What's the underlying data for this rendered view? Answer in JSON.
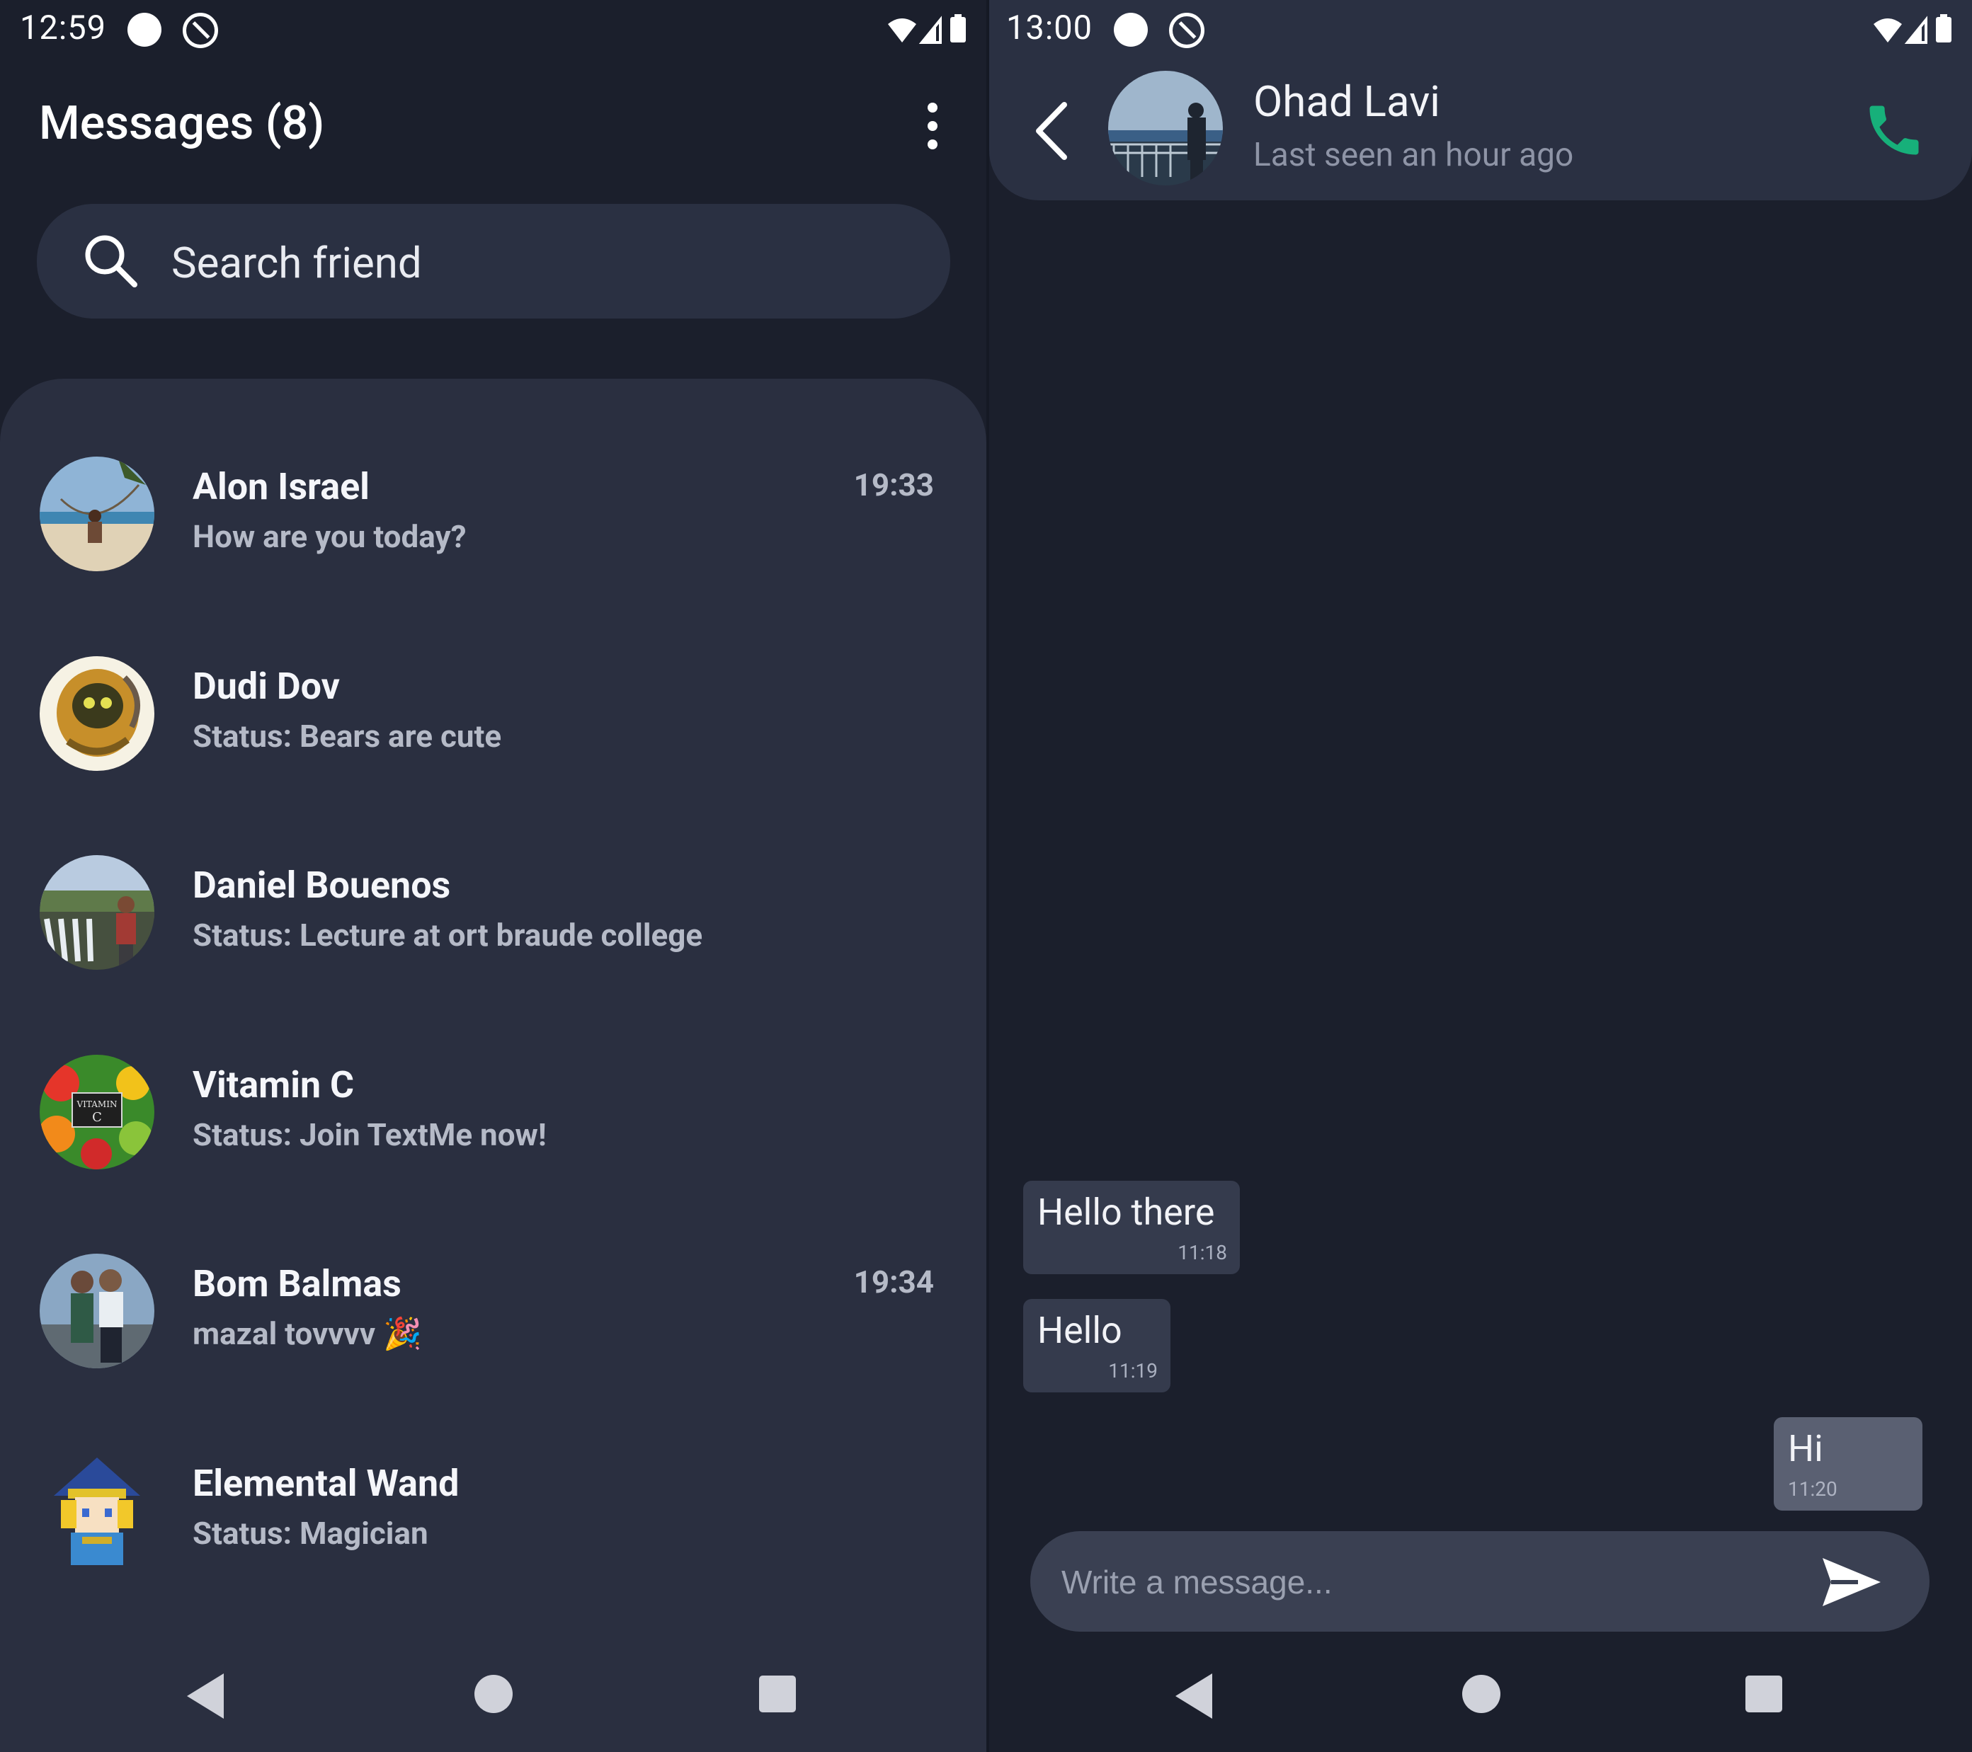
{
  "colors": {
    "background": "#1b1f2c",
    "card": "#2a2f40",
    "accent_call": "#17b07a"
  },
  "left": {
    "status_time": "12:59",
    "title": "Messages (8)",
    "search_placeholder": "Search friend",
    "contacts": [
      {
        "name": "Alon Israel",
        "subtitle": "How are you today?",
        "time": "19:33",
        "avatar": "beach-hammock-photo"
      },
      {
        "name": "Dudi Dov",
        "subtitle": "Status: Bears are cute",
        "time": "",
        "avatar": "creature-illustration"
      },
      {
        "name": "Daniel Bouenos",
        "subtitle": "Status: Lecture at ort braude college",
        "time": "",
        "avatar": "waterfall-photo"
      },
      {
        "name": "Vitamin C",
        "subtitle": "Status: Join TextMe now!",
        "time": "",
        "avatar": "fruits-photo"
      },
      {
        "name": "Bom Balmas",
        "subtitle": "mazal tovvvv 🎉",
        "time": "19:34",
        "avatar": "couple-photo"
      },
      {
        "name": "Elemental Wand",
        "subtitle": "Status: Magician",
        "time": "",
        "avatar": "pixel-wizard"
      }
    ]
  },
  "right": {
    "status_time": "13:00",
    "contact_name": "Ohad Lavi",
    "last_seen": "Last seen an hour ago",
    "messages": [
      {
        "text": "Hello there",
        "time": "11:18",
        "direction": "in"
      },
      {
        "text": "Hello",
        "time": "11:19",
        "direction": "in"
      },
      {
        "text": "Hi",
        "time": "11:20",
        "direction": "out"
      }
    ],
    "composer_placeholder": "Write a message..."
  },
  "avatar_texts": {
    "vitamin_sign_line1": "VITAMIN",
    "vitamin_sign_line2": "C"
  },
  "icons": [
    "wifi-icon",
    "signal-icon",
    "battery-icon",
    "more-vert-icon",
    "search-icon",
    "back-chevron-icon",
    "phone-icon",
    "send-icon"
  ]
}
